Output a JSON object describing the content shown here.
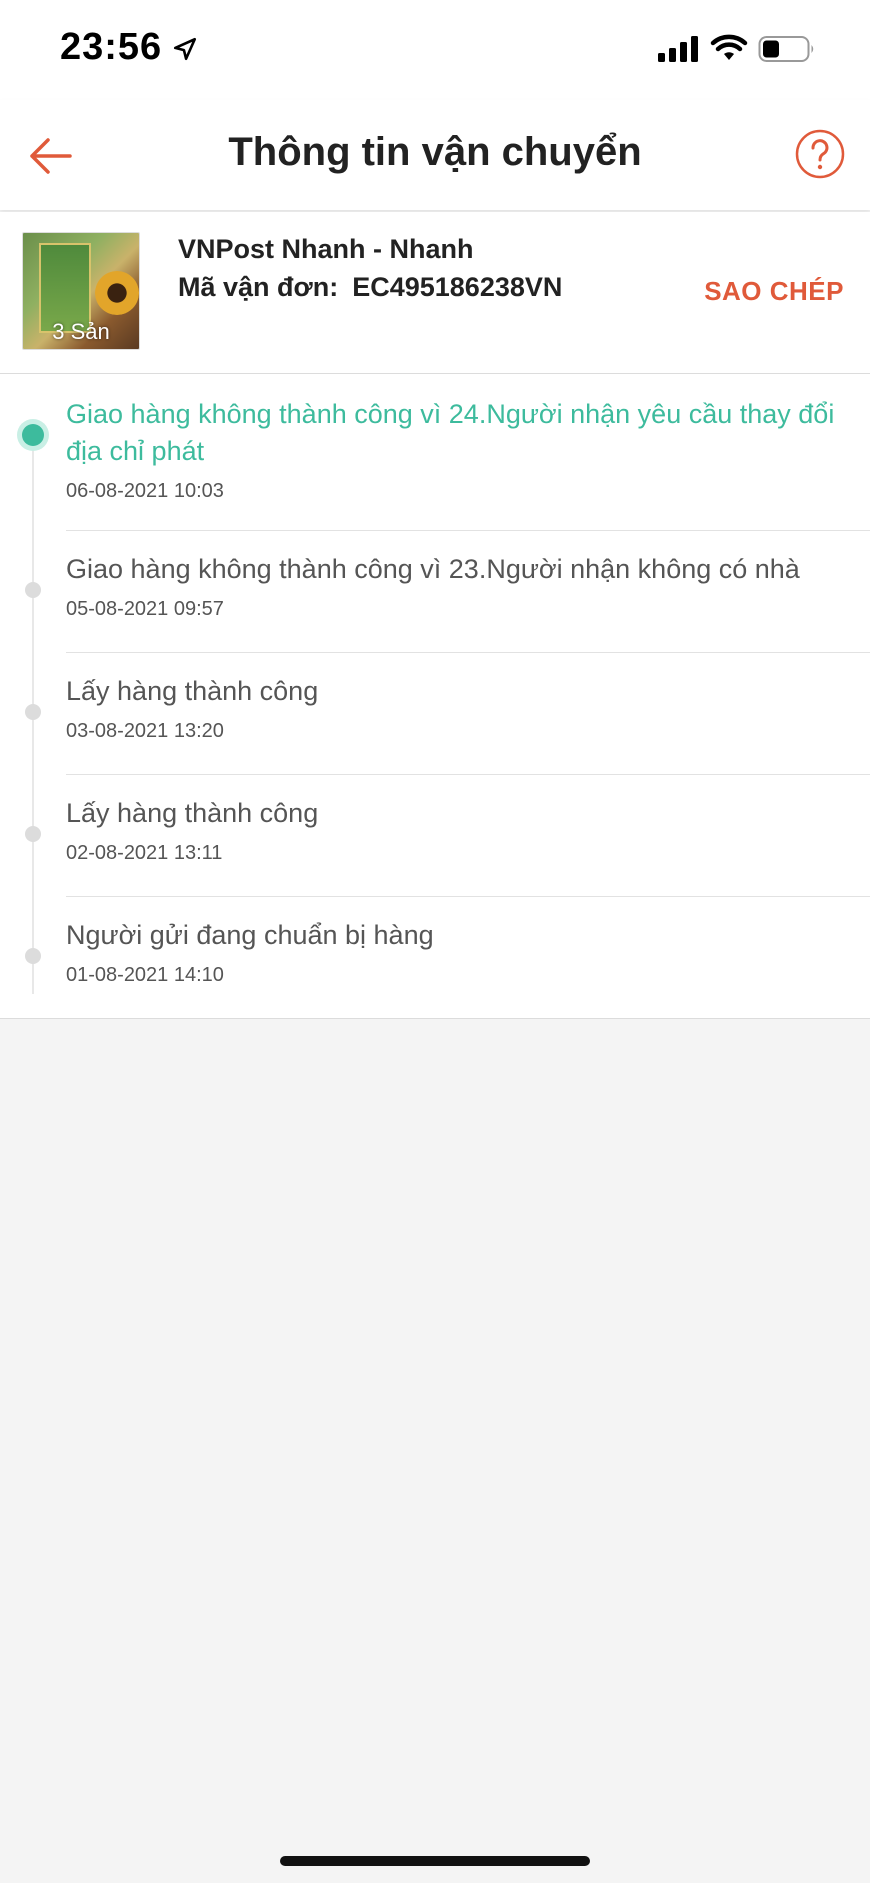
{
  "status_bar": {
    "time": "23:56"
  },
  "header": {
    "title": "Thông tin vận chuyển"
  },
  "shipment": {
    "thumbnail_label": "3 Sản",
    "carrier": "VNPost Nhanh - Nhanh",
    "tracking_label": "Mã vận đơn:",
    "tracking_code": "EC495186238VN",
    "copy_label": "SAO CHÉP"
  },
  "timeline": [
    {
      "status": "Giao hàng không thành công vì 24.Người nhận yêu cầu thay đổi địa chỉ phát",
      "time": "06-08-2021 10:03",
      "active": true
    },
    {
      "status": "Giao hàng không thành công vì 23.Người nhận không có nhà",
      "time": "05-08-2021 09:57",
      "active": false
    },
    {
      "status": "Lấy hàng thành công",
      "time": "03-08-2021 13:20",
      "active": false
    },
    {
      "status": "Lấy hàng thành công",
      "time": "02-08-2021 13:11",
      "active": false
    },
    {
      "status": "Người gửi đang chuẩn bị hàng",
      "time": "01-08-2021 14:10",
      "active": false
    }
  ],
  "colors": {
    "accent": "#e05a3a",
    "active_status": "#3dbb9d"
  }
}
